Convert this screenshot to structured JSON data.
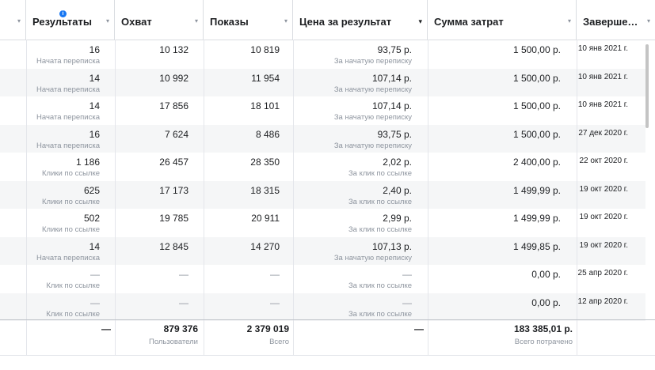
{
  "columns": [
    {
      "label": "",
      "sort": "▾"
    },
    {
      "label": "Результаты",
      "sort": "▾",
      "info": "i"
    },
    {
      "label": "Охват",
      "sort": "▾"
    },
    {
      "label": "Показы",
      "sort": "▾"
    },
    {
      "label": "Цена за результат",
      "sort": "▾"
    },
    {
      "label": "Сумма затрат",
      "sort": "▾"
    },
    {
      "label": "Заверше…",
      "sort": "▾"
    }
  ],
  "rows": [
    {
      "results": "16",
      "results_sub": "Начата переписка",
      "reach": "10 132",
      "impressions": "10 819",
      "cpr": "93,75 р.",
      "cpr_sub": "За начатую переписку",
      "spend": "1 500,00 р.",
      "ends": "10 янв 2021 г."
    },
    {
      "results": "14",
      "results_sub": "Начата переписка",
      "reach": "10 992",
      "impressions": "11 954",
      "cpr": "107,14 р.",
      "cpr_sub": "За начатую переписку",
      "spend": "1 500,00 р.",
      "ends": "10 янв 2021 г."
    },
    {
      "results": "14",
      "results_sub": "Начата переписка",
      "reach": "17 856",
      "impressions": "18 101",
      "cpr": "107,14 р.",
      "cpr_sub": "За начатую переписку",
      "spend": "1 500,00 р.",
      "ends": "10 янв 2021 г."
    },
    {
      "results": "16",
      "results_sub": "Начата переписка",
      "reach": "7 624",
      "impressions": "8 486",
      "cpr": "93,75 р.",
      "cpr_sub": "За начатую переписку",
      "spend": "1 500,00 р.",
      "ends": "27 дек 2020 г."
    },
    {
      "results": "1 186",
      "results_sub": "Клики по ссылке",
      "reach": "26 457",
      "impressions": "28 350",
      "cpr": "2,02 р.",
      "cpr_sub": "За клик по ссылке",
      "spend": "2 400,00 р.",
      "ends": "22 окт 2020 г."
    },
    {
      "results": "625",
      "results_sub": "Клики по ссылке",
      "reach": "17 173",
      "impressions": "18 315",
      "cpr": "2,40 р.",
      "cpr_sub": "За клик по ссылке",
      "spend": "1 499,99 р.",
      "ends": "19 окт 2020 г."
    },
    {
      "results": "502",
      "results_sub": "Клики по ссылке",
      "reach": "19 785",
      "impressions": "20 911",
      "cpr": "2,99 р.",
      "cpr_sub": "За клик по ссылке",
      "spend": "1 499,99 р.",
      "ends": "19 окт 2020 г."
    },
    {
      "results": "14",
      "results_sub": "Начата переписка",
      "reach": "12 845",
      "impressions": "14 270",
      "cpr": "107,13 р.",
      "cpr_sub": "За начатую переписку",
      "spend": "1 499,85 р.",
      "ends": "19 окт 2020 г."
    },
    {
      "results": "—",
      "results_sub": "Клик по ссылке",
      "reach": "—",
      "impressions": "—",
      "cpr": "—",
      "cpr_sub": "За клик по ссылке",
      "spend": "0,00 р.",
      "ends": "25 апр 2020 г."
    },
    {
      "results": "—",
      "results_sub": "Клик по ссылке",
      "reach": "—",
      "impressions": "—",
      "cpr": "—",
      "cpr_sub": "За клик по ссылке",
      "spend": "0,00 р.",
      "ends": "12 апр 2020 г."
    }
  ],
  "totals": {
    "results": "—",
    "reach": "879 376",
    "reach_sub": "Пользователи",
    "impressions": "2 379 019",
    "impressions_sub": "Всего",
    "cpr": "—",
    "spend": "183 385,01 р.",
    "spend_sub": "Всего потрачено"
  },
  "colors": {
    "accent": "#1877f2",
    "alt_row": "#f5f6f7",
    "muted": "#8d949e",
    "border": "#dadde1"
  }
}
